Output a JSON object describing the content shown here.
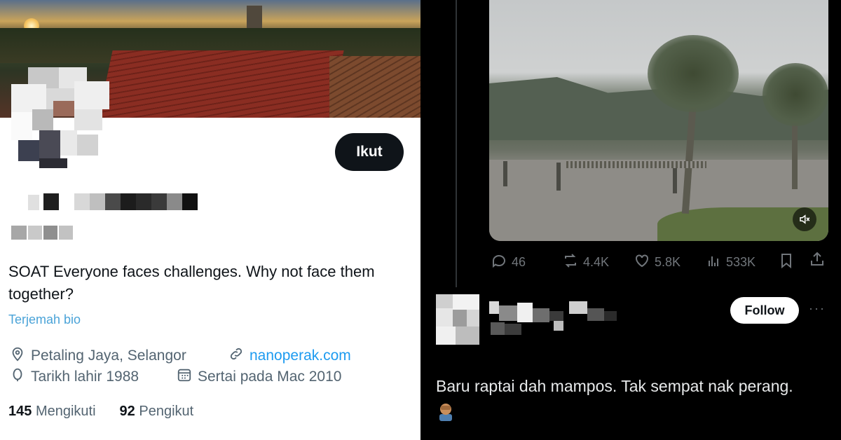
{
  "profile": {
    "follow_button": "Ikut",
    "bio": "SOAT Everyone faces challenges. Why not face them together?",
    "translate_link": "Terjemah bio",
    "location": "Petaling Jaya, Selangor",
    "website": "nanoperak.com",
    "birth": "Tarikh lahir 1988",
    "joined": "Sertai pada Mac 2010",
    "following_count": "145",
    "following_label": "Mengikuti",
    "followers_count": "92",
    "followers_label": "Pengikut",
    "icons": [
      "location-icon",
      "link-icon",
      "birthday-icon",
      "calendar-icon"
    ]
  },
  "post": {
    "stats": {
      "replies": "46",
      "reposts": "4.4K",
      "likes": "5.8K",
      "views": "533K"
    },
    "icons": [
      "reply-icon",
      "repost-icon",
      "like-icon",
      "views-icon",
      "bookmark-icon",
      "share-icon",
      "mute-icon"
    ]
  },
  "reply": {
    "follow_button": "Follow",
    "more": "···",
    "text": "Baru raptai dah mampos. Tak sempat nak perang."
  },
  "colors": {
    "link": "#1d9bf0",
    "translate": "#4aa3d8",
    "dark_button": "#0f1419",
    "muted_text": "#71767b"
  }
}
